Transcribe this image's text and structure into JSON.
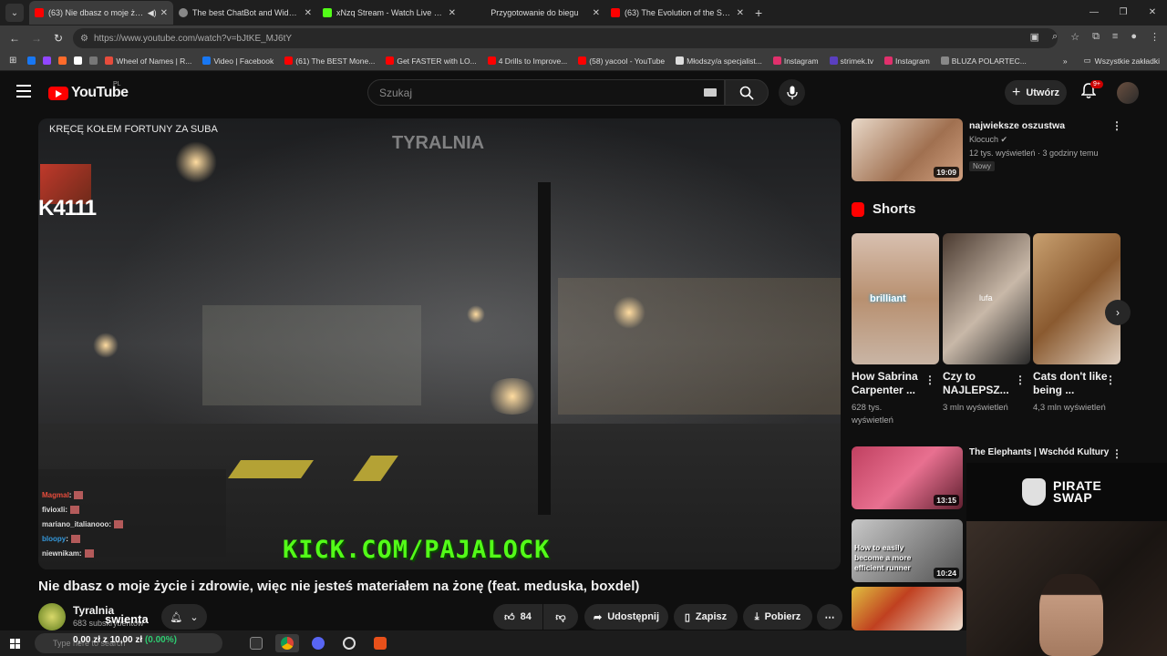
{
  "browser": {
    "tabs": [
      {
        "title": "(63) Nie dbasz o moje życie",
        "color": "#ff0000"
      },
      {
        "title": "The best ChatBot and Widgets",
        "color": "#888888"
      },
      {
        "title": "xNzq Stream - Watch Live on K",
        "color": "#53fc18"
      },
      {
        "title": "Przygotowanie do biegu",
        "color": "#4a4a4a"
      },
      {
        "title": "(63) The Evolution of the Sun in",
        "color": "#ff0000"
      }
    ],
    "url": "https://www.youtube.com/watch?v=bJtKE_MJ6tY",
    "bookmarks": [
      {
        "label": "",
        "color": "#1877f2"
      },
      {
        "label": "",
        "color": "#9146ff"
      },
      {
        "label": "",
        "color": "#ff6b2b"
      },
      {
        "label": "",
        "color": "#ffffff"
      },
      {
        "label": "",
        "color": "#777777"
      },
      {
        "label": "Wheel of Names | R...",
        "color": "#e74c3c"
      },
      {
        "label": "Video | Facebook",
        "color": "#1877f2"
      },
      {
        "label": "(61) The BEST Mone...",
        "color": "#ff0000"
      },
      {
        "label": "Get FASTER with LO...",
        "color": "#ff0000"
      },
      {
        "label": "4 Drills to Improve...",
        "color": "#ff0000"
      },
      {
        "label": "(58) yacool - YouTube",
        "color": "#ff0000"
      },
      {
        "label": "Młodszy/a specjalist...",
        "color": "#dddddd"
      },
      {
        "label": "Instagram",
        "color": "#e1306c"
      },
      {
        "label": "strimek.tv",
        "color": "#5a3fc0"
      },
      {
        "label": "Instagram",
        "color": "#e1306c"
      },
      {
        "label": "BLUZA POLARTEC...",
        "color": "#888888"
      }
    ],
    "all_bookmarks": "Wszystkie zakładki"
  },
  "youtube": {
    "logo": "YouTube",
    "region": "PL",
    "search_placeholder": "Szukaj",
    "create_label": "Utwórz",
    "notif_count": "9+"
  },
  "player": {
    "overlay_title": "KRĘCĘ KOŁEM FORTUNY ZA SUBA",
    "watermark": "TYRALNIA",
    "counter": "K4111",
    "chat": [
      {
        "user": "Magmal",
        "color": "#e74c3c"
      },
      {
        "user": "fivioxli",
        "color": "#dddddd"
      },
      {
        "user": "mariano_italianooo",
        "color": "#dddddd"
      },
      {
        "user": "bloopy",
        "color": "#3498db"
      },
      {
        "user": "niewnikam",
        "color": "#dddddd"
      }
    ],
    "kick_text": "KICK.COM/PAJALOCK"
  },
  "video": {
    "title": "Nie dbasz o moje życie i zdrowie, więc nie jesteś materiałem na żonę (feat. meduska, boxdel)",
    "channel": "Tyralnia",
    "subs": "683 subskrybentów",
    "overlay_name": "swienta",
    "likes": "84",
    "share": "Udostępnij",
    "save": "Zapisz",
    "download": "Pobierz"
  },
  "sidebar": {
    "top_video": {
      "title": "najwieksze oszustwa",
      "channel": "Klocuch",
      "meta": "12 tys. wyświetleń · 3 godziny temu",
      "badge": "Nowy",
      "duration": "19:09"
    },
    "shorts_heading": "Shorts",
    "shorts": [
      {
        "title": "How Sabrina Carpenter ...",
        "views": "628 tys. wyświetleń",
        "caption": "brilliant"
      },
      {
        "title": "Czy to NAJLEPSZ...",
        "views": "3 mln wyświetleń",
        "caption": "lufa"
      },
      {
        "title": "Cats don't like being ...",
        "views": "4,3 mln wyświetleń",
        "caption": ""
      }
    ],
    "videos": [
      {
        "title": "The Elephants | Wschód Kultury",
        "duration": "13:15"
      },
      {
        "title": "How to easily become a more efficient runner",
        "duration": "10:24"
      },
      {
        "title": "",
        "duration": ""
      }
    ],
    "pirate": "PIRATE SWAP"
  },
  "taskbar": {
    "search_placeholder": "Type here to search",
    "money": "0,00 zł",
    "money_of": "z 10,00 zł",
    "money_pct": "(0.00%)"
  }
}
